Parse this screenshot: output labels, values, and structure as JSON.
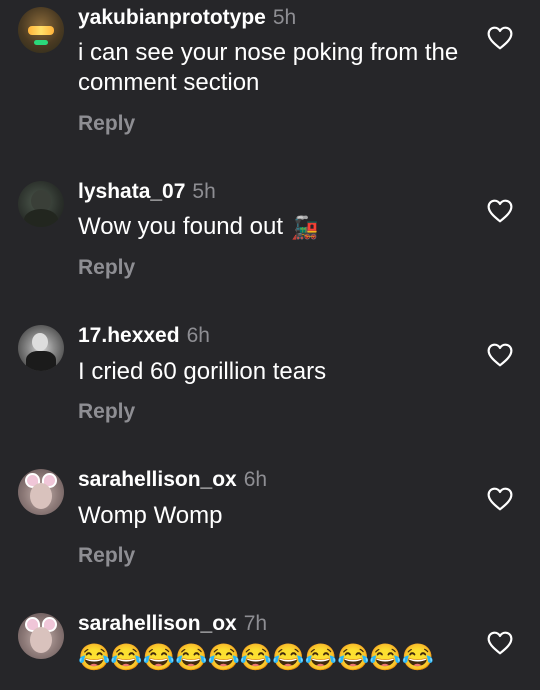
{
  "comments": [
    {
      "username": "yakubianprototype",
      "time": "5h",
      "text": "i can see your nose poking from the comment section",
      "reply_label": "Reply",
      "avatar_icon": "helmet-visor-avatar",
      "like_icon": "heart-outline-icon"
    },
    {
      "username": "lyshata_07",
      "time": "5h",
      "text": "Wow you found out",
      "emoji": "🚂",
      "reply_label": "Reply",
      "avatar_icon": "dark-figure-avatar",
      "like_icon": "heart-outline-icon"
    },
    {
      "username": "17.hexxed",
      "time": "6h",
      "text": "I cried 60 gorillion tears",
      "reply_label": "Reply",
      "avatar_icon": "monochrome-figure-avatar",
      "like_icon": "heart-outline-icon"
    },
    {
      "username": "sarahellison_ox",
      "time": "6h",
      "text": "Womp Womp",
      "reply_label": "Reply",
      "avatar_icon": "cat-ears-filter-avatar",
      "like_icon": "heart-outline-icon"
    },
    {
      "username": "sarahellison_ox",
      "time": "7h",
      "text": "",
      "emoji_sequence": "😂😂😂😂😂😂😂😂😂😂😂",
      "avatar_icon": "cat-ears-filter-avatar",
      "like_icon": "heart-outline-icon"
    }
  ],
  "colors": {
    "background": "#262629",
    "primary_text": "#ffffff",
    "secondary_text": "#8e8e93"
  }
}
